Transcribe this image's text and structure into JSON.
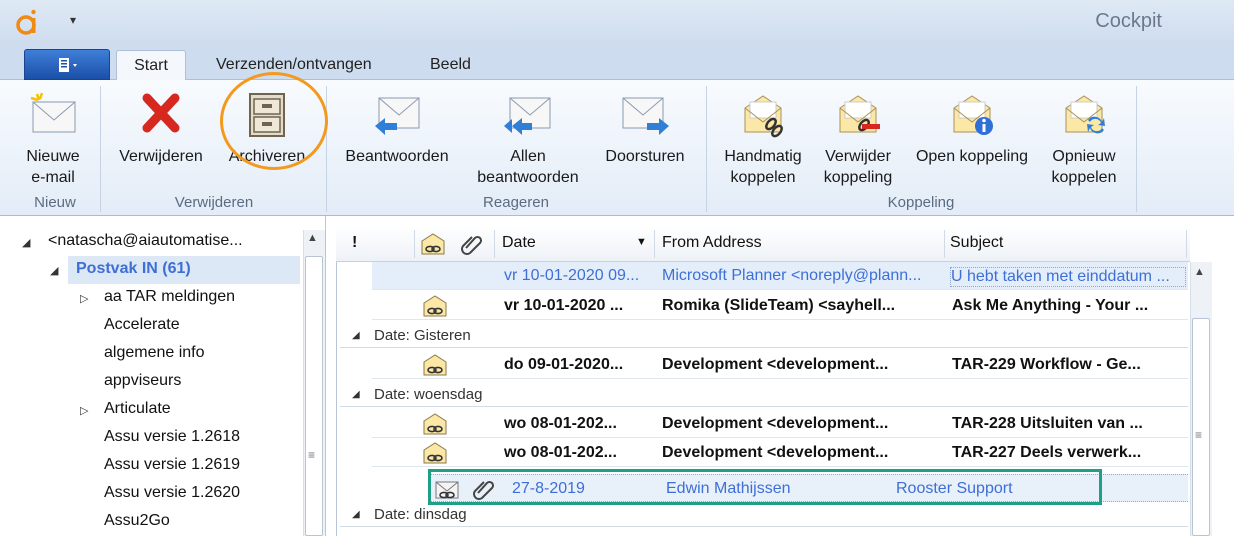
{
  "window": {
    "title": "Cockpit"
  },
  "tabs": [
    {
      "label": "Start"
    },
    {
      "label": "Verzenden/ontvangen"
    },
    {
      "label": "Beeld"
    }
  ],
  "ribbon": {
    "new_email": "Nieuwe\ne-mail",
    "group_new": "Nieuw",
    "delete": "Verwijderen",
    "archive": "Archiveren",
    "group_delete": "Verwijderen",
    "reply": "Beantwoorden",
    "reply_all": "Allen\nbeantwoorden",
    "forward": "Doorsturen",
    "group_respond": "Reageren",
    "manual_link": "Handmatig\nkoppelen",
    "remove_link": "Verwijder\nkoppeling",
    "open_link": "Open koppeling",
    "relink": "Opnieuw\nkoppelen",
    "group_link": "Koppeling"
  },
  "nav": {
    "account": "<natascha@aiautomatise...",
    "inbox": "Postvak IN (61)",
    "folders": [
      "aa TAR meldingen",
      "Accelerate",
      "algemene info",
      "appviseurs",
      "Articulate",
      "Assu versie 1.2618",
      "Assu versie 1.2619",
      "Assu versie 1.2620",
      "Assu2Go"
    ]
  },
  "list": {
    "columns": {
      "importance": "!",
      "date": "Date",
      "from": "From Address",
      "subject": "Subject"
    },
    "rows": [
      {
        "date": "vr 10-01-2020 09...",
        "from": "Microsoft Planner <noreply@plann...",
        "subject": "U hebt taken met einddatum ..."
      },
      {
        "date": "vr 10-01-2020 ...",
        "from": "Romika (SlideTeam) <sayhell...",
        "subject": "Ask Me Anything - Your ..."
      },
      {
        "date": "do 09-01-2020...",
        "from": "Development <development...",
        "subject": "TAR-229 Workflow - Ge..."
      },
      {
        "date": "wo 08-01-202...",
        "from": "Development <development...",
        "subject": "TAR-228 Uitsluiten van ..."
      },
      {
        "date": "wo 08-01-202...",
        "from": "Development <development...",
        "subject": "TAR-227 Deels verwerk..."
      },
      {
        "date": "27-8-2019",
        "from": "Edwin Mathijssen",
        "subject": "Rooster Support"
      }
    ],
    "groups": [
      "Date: Gisteren",
      "Date: woensdag",
      "Date: dinsdag"
    ]
  },
  "colors": {
    "accent": "#1b4fa8",
    "highlight_orange": "#f39a1e",
    "highlight_green": "#1f9f86",
    "unread_blue": "#3d6fd6"
  }
}
